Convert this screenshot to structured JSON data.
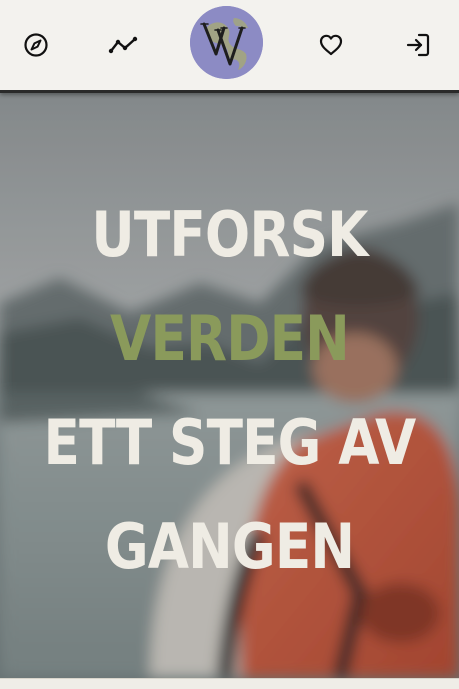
{
  "header": {
    "nav": [
      {
        "id": "explore",
        "icon": "compass-icon"
      },
      {
        "id": "stats",
        "icon": "trend-line-icon"
      },
      {
        "id": "favorites",
        "icon": "heart-icon"
      },
      {
        "id": "login",
        "icon": "sign-in-icon"
      }
    ],
    "logo": {
      "monogram": "VV",
      "color": "#8c8bc4"
    }
  },
  "hero": {
    "lines": [
      "UTFORSK",
      "VERDEN",
      "ETT STEG AV",
      "GANGEN"
    ],
    "accent_color": "#8a9a5b",
    "text_color": "#efece4"
  }
}
